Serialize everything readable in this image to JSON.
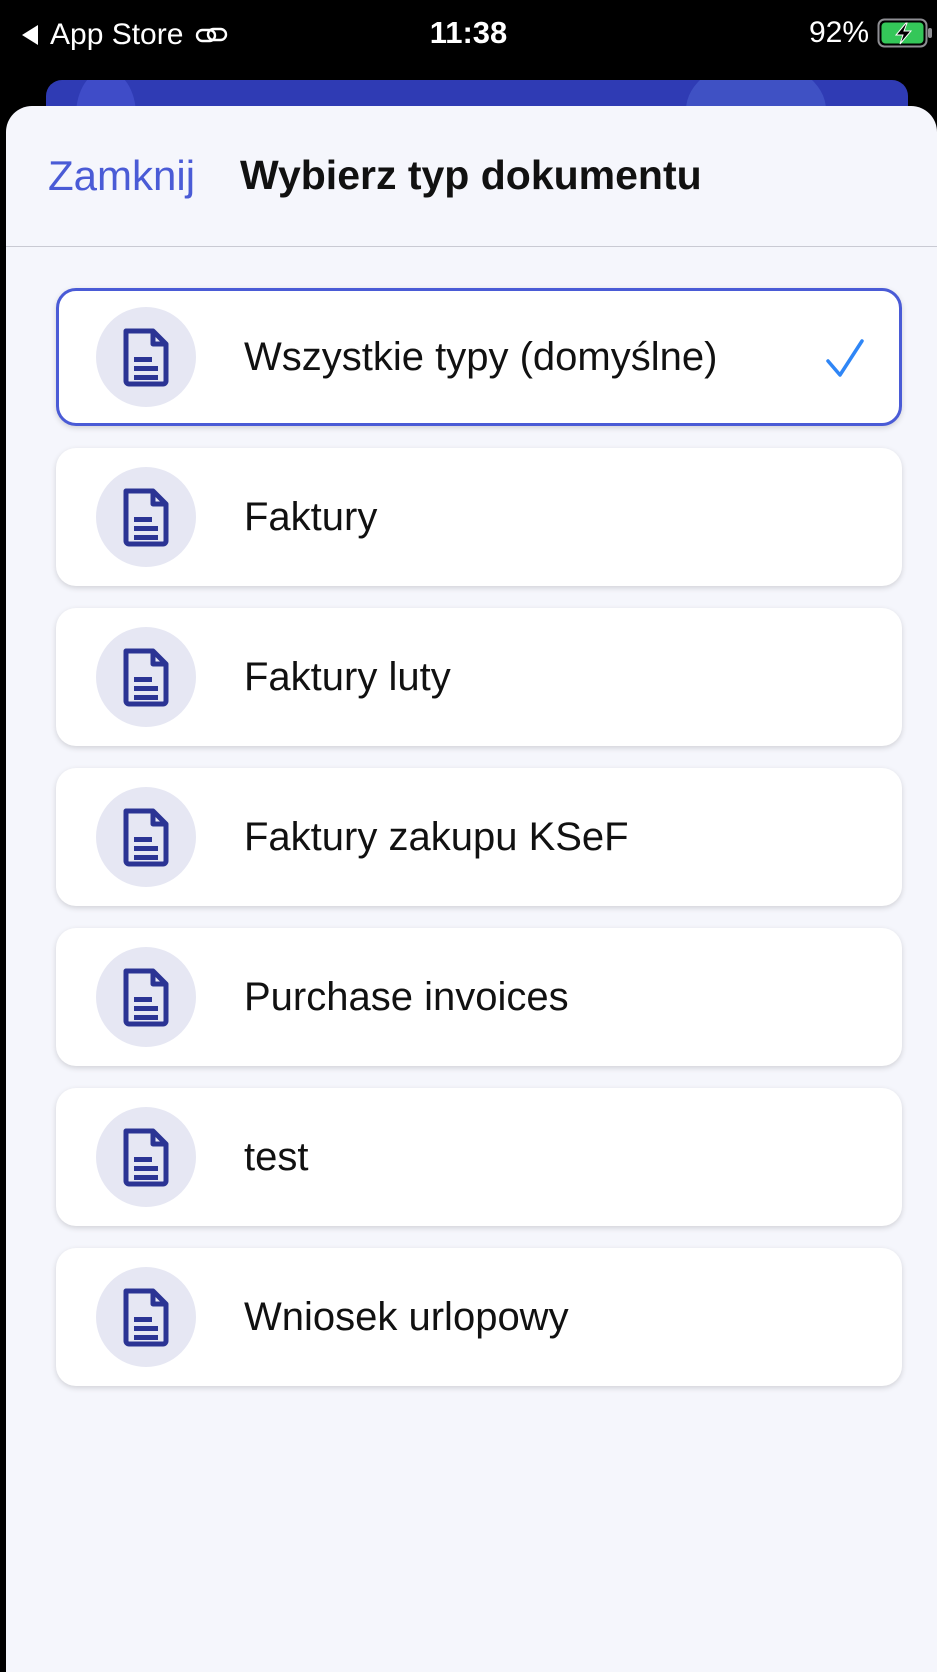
{
  "status_bar": {
    "back_label": "App Store",
    "time": "11:38",
    "battery_percent": "92%",
    "battery_color": "#34c759"
  },
  "header": {
    "close_label": "Zamknij",
    "title": "Wybierz typ dokumentu"
  },
  "document_types": [
    {
      "label": "Wszystkie typy (domyślne)",
      "selected": true
    },
    {
      "label": "Faktury",
      "selected": false
    },
    {
      "label": "Faktury luty",
      "selected": false
    },
    {
      "label": "Faktury zakupu KSeF",
      "selected": false
    },
    {
      "label": "Purchase invoices",
      "selected": false
    },
    {
      "label": "test",
      "selected": false
    },
    {
      "label": "Wniosek urlopowy",
      "selected": false
    }
  ],
  "colors": {
    "accent": "#4a5bd6",
    "icon_fg": "#2b3494",
    "icon_bg": "#e6e7f3",
    "checkmark": "#2f86f6"
  },
  "icons": {
    "item_icon": "document-icon",
    "selected_icon": "checkmark-icon"
  }
}
